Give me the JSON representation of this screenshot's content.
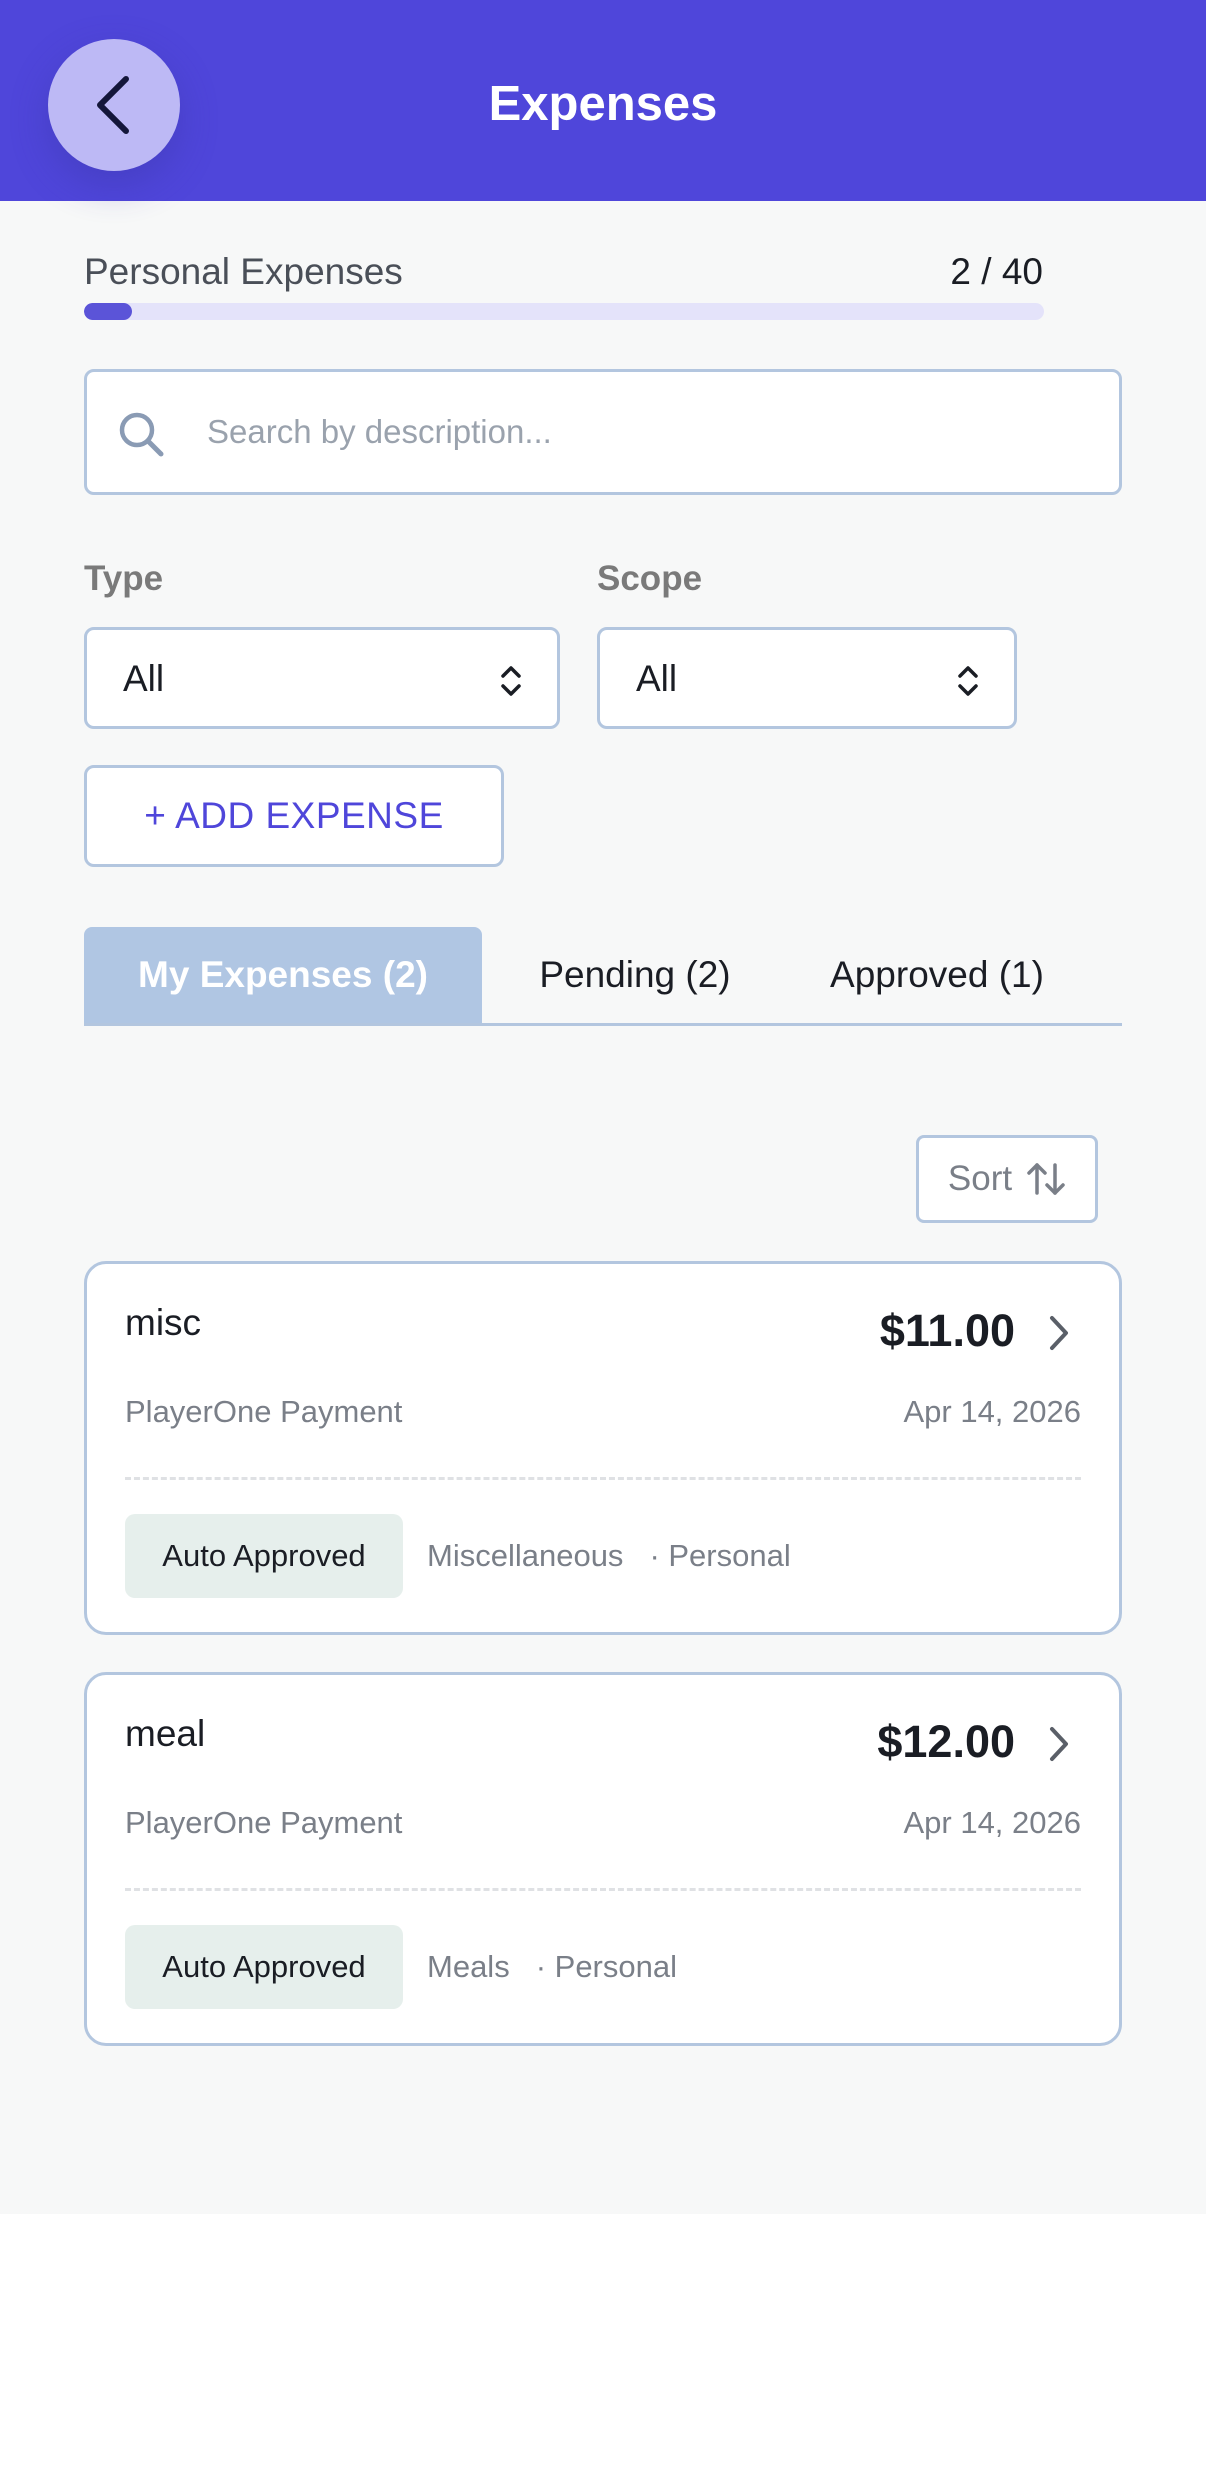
{
  "header": {
    "title": "Expenses"
  },
  "quota": {
    "label": "Personal Expenses",
    "count": "2 / 40",
    "used_fraction": 0.05
  },
  "search": {
    "placeholder": "Search by description..."
  },
  "filters": {
    "type": {
      "label": "Type",
      "value": "All"
    },
    "scope": {
      "label": "Scope",
      "value": "All"
    }
  },
  "actions": {
    "add_label": "+ ADD EXPENSE",
    "sort_label": "Sort"
  },
  "tabs": [
    {
      "label": "My Expenses (2)",
      "active": true
    },
    {
      "label": "Pending (2)",
      "active": false
    },
    {
      "label": "Approved (1)",
      "active": false
    }
  ],
  "expenses": [
    {
      "title": "misc",
      "amount": "$11.00",
      "source": "PlayerOne Payment",
      "date": "Apr 14, 2026",
      "status": "Auto Approved",
      "category": "Miscellaneous",
      "scope": "· Personal"
    },
    {
      "title": "meal",
      "amount": "$12.00",
      "source": "PlayerOne Payment",
      "date": "Apr 14, 2026",
      "status": "Auto Approved",
      "category": "Meals",
      "scope": "· Personal"
    }
  ],
  "colors": {
    "primary": "#4f46da",
    "active_tab": "#b0c6e3",
    "badge_bg": "#e6efec",
    "border": "#b3c6df"
  },
  "icons": {
    "back": "chevron-left-icon",
    "search": "search-icon",
    "select": "up-down-arrows-icon",
    "sort": "sort-arrows-icon",
    "card": "chevron-right-icon"
  }
}
